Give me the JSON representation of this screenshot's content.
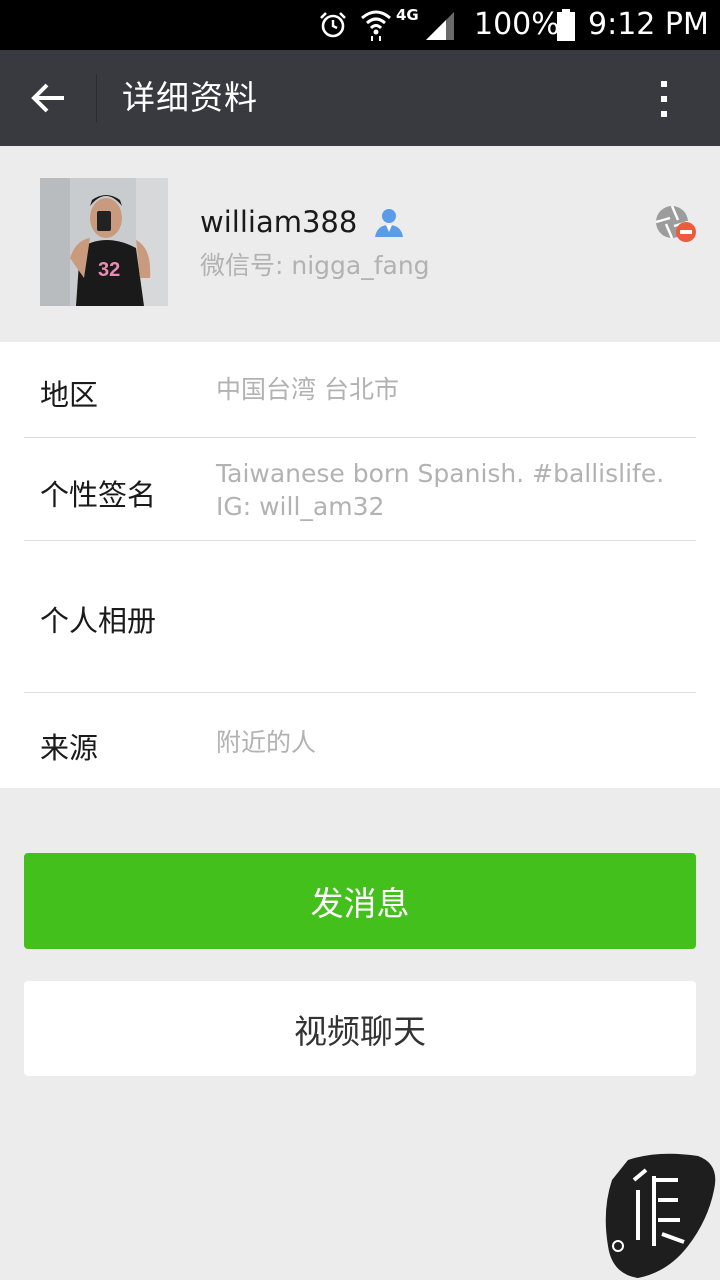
{
  "status_bar": {
    "network": "4G",
    "battery": "100%",
    "time": "9:12 PM"
  },
  "header": {
    "title": "详细资料",
    "icons": [
      "back-arrow-icon",
      "more-vertical-icon"
    ]
  },
  "profile": {
    "nickname": "william388",
    "wechat_id": "微信号: nigga_fang",
    "icons": [
      "contact-person-icon",
      "moments-blocked-icon"
    ]
  },
  "info": {
    "region_label": "地区",
    "region_value": "中国台湾  台北市",
    "signature_label": "个性签名",
    "signature_line1": "Taiwanese born Spanish. #ballislife.",
    "signature_line2": "IG: will_am32",
    "album_label": "个人相册",
    "source_label": "来源",
    "source_value": "附近的人"
  },
  "actions": {
    "send_message": "发消息",
    "video_chat": "视频聊天"
  },
  "colors": {
    "title_bar": "#393a3f",
    "accent_green": "#44c01c",
    "background": "#ececec"
  }
}
